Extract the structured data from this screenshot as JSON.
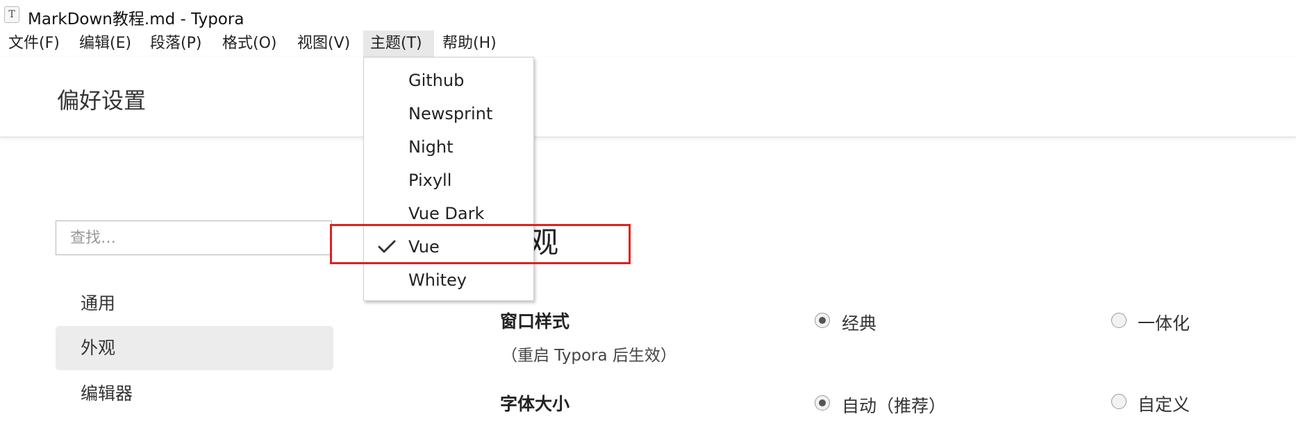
{
  "window": {
    "title": "MarkDown教程.md - Typora",
    "icon_glyph": "T"
  },
  "menubar": {
    "items": [
      {
        "label": "文件(F)"
      },
      {
        "label": "编辑(E)"
      },
      {
        "label": "段落(P)"
      },
      {
        "label": "格式(O)"
      },
      {
        "label": "视图(V)"
      },
      {
        "label": "主题(T)",
        "active": true
      },
      {
        "label": "帮助(H)"
      }
    ]
  },
  "preferences": {
    "title": "偏好设置",
    "search": {
      "placeholder": "查找…",
      "value": ""
    },
    "nav": [
      {
        "label": "通用"
      },
      {
        "label": "外观",
        "selected": true
      },
      {
        "label": "编辑器"
      }
    ],
    "section_title": "外观",
    "section_title_visible": "观",
    "settings": {
      "window_style": {
        "label": "窗口样式",
        "note": "（重启 Typora 后生效）",
        "options": [
          {
            "label": "经典",
            "checked": true
          },
          {
            "label": "一体化",
            "checked": false
          }
        ]
      },
      "font_size": {
        "label": "字体大小",
        "options": [
          {
            "label": "自动（推荐）",
            "checked": true
          },
          {
            "label": "自定义",
            "checked": false
          }
        ]
      }
    }
  },
  "theme_menu": {
    "items": [
      {
        "label": "Github",
        "checked": false
      },
      {
        "label": "Newsprint",
        "checked": false
      },
      {
        "label": "Night",
        "checked": false
      },
      {
        "label": "Pixyll",
        "checked": false
      },
      {
        "label": "Vue Dark",
        "checked": false
      },
      {
        "label": "Vue",
        "checked": true
      },
      {
        "label": "Whitey",
        "checked": false
      }
    ]
  },
  "colors": {
    "highlight_border": "#e02020",
    "selected_nav_bg": "#ececec"
  }
}
